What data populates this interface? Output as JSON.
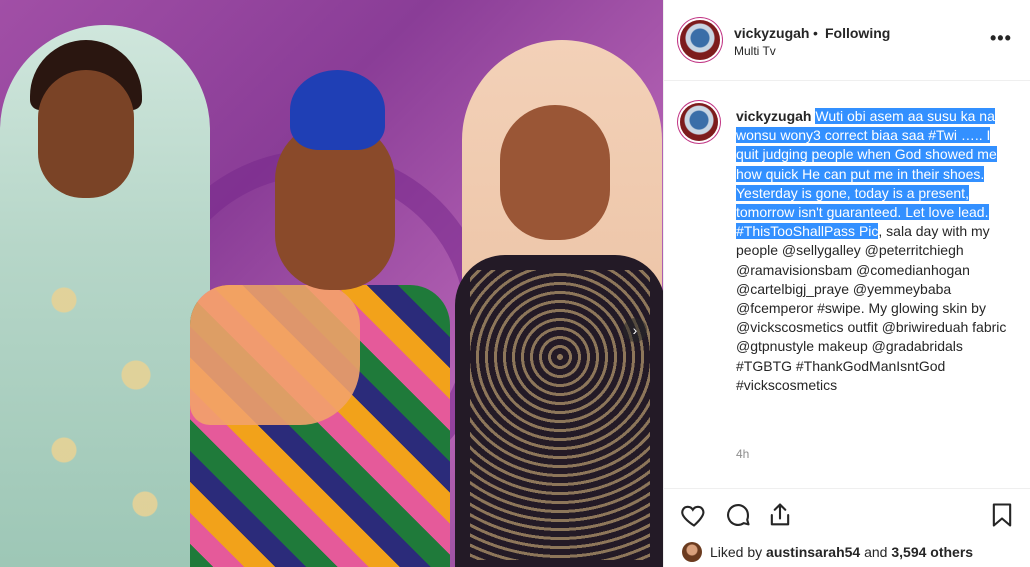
{
  "post": {
    "carousel_next_glyph": "›"
  },
  "header": {
    "username": "vickyzugah",
    "separator": "•",
    "follow_state": "Following",
    "location": "Multi Tv",
    "more_glyph": "•••"
  },
  "caption": {
    "username": "vickyzugah",
    "selected_text": "Wuti obi asem aa susu ka na wonsu wony3 correct biaa saa #Twi ….. I quit judging people when God showed me how quick He can put me in their shoes. Yesterday is gone, today is a present, tomorrow isn't guaranteed. Let love lead. #ThisTooShallPass Pic",
    "rest_text": ", sala day with my people @sellygalley @peterritchiegh @ramavisionsbam @comedianhogan @cartelbigj_praye @yemmeybaba @fcemperor #swipe. My glowing skin by @vickscosmetics outfit @briwireduah fabric @gtpnustyle makeup @gradabridals #TGBTG #ThankGodManIsntGod #vickscosmetics",
    "timestamp": "4h"
  },
  "likes": {
    "prefix": "Liked by",
    "user": "austinsarah54",
    "middle": "and",
    "count": "3,594 others"
  },
  "icons": {
    "like": "heart-icon",
    "comment": "comment-icon",
    "share": "share-icon",
    "save": "bookmark-icon",
    "more": "more-icon"
  }
}
